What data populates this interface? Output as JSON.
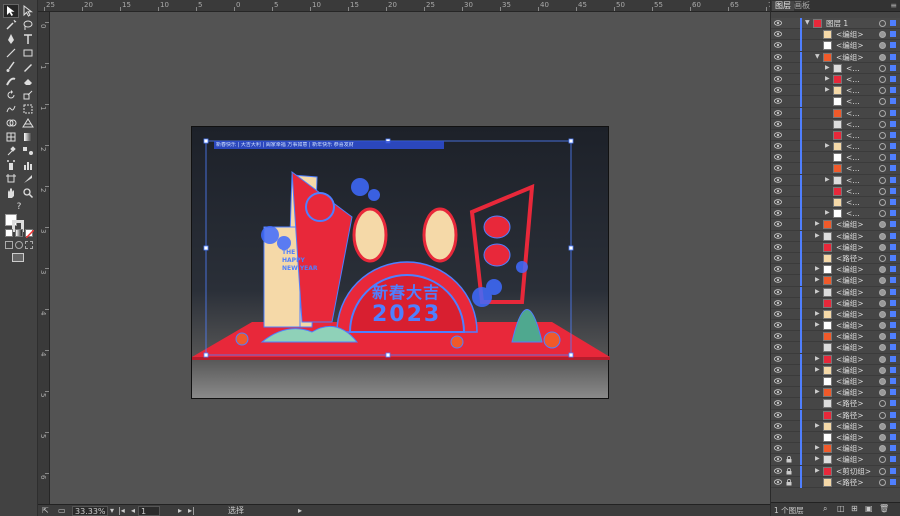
{
  "statusbar": {
    "zoom": "33.33%",
    "artboard_number": "1",
    "tool_status": "选择"
  },
  "ruler": {
    "top": [
      "25",
      "20",
      "15",
      "10",
      "5",
      "0",
      "5",
      "10",
      "15",
      "20",
      "25",
      "30",
      "35",
      "40",
      "45",
      "50",
      "55",
      "60",
      "65",
      "70"
    ],
    "left": [
      "0",
      "1",
      "1",
      "2",
      "2",
      "3",
      "3",
      "4",
      "4",
      "5",
      "5",
      "6"
    ]
  },
  "layers_panel": {
    "tabs": [
      "图层",
      "画板"
    ],
    "footer_text": "1 个图层",
    "rows": [
      {
        "name": "图层 1",
        "indent": 0,
        "arrow": "▼",
        "target": "empty",
        "highlight": true
      },
      {
        "name": "<编组>",
        "indent": 1,
        "arrow": "",
        "target": "filled"
      },
      {
        "name": "<编组>",
        "indent": 1,
        "arrow": "",
        "target": "filled"
      },
      {
        "name": "<编组>",
        "indent": 1,
        "arrow": "▼",
        "target": "filled"
      },
      {
        "name": "<…",
        "indent": 2,
        "arrow": "▶",
        "target": "empty"
      },
      {
        "name": "<…",
        "indent": 2,
        "arrow": "▶",
        "target": "empty"
      },
      {
        "name": "<…",
        "indent": 2,
        "arrow": "▶",
        "target": "empty"
      },
      {
        "name": "<…",
        "indent": 2,
        "arrow": "",
        "target": "empty"
      },
      {
        "name": "<…",
        "indent": 2,
        "arrow": "",
        "target": "empty"
      },
      {
        "name": "<…",
        "indent": 2,
        "arrow": "",
        "target": "empty"
      },
      {
        "name": "<…",
        "indent": 2,
        "arrow": "",
        "target": "empty"
      },
      {
        "name": "<…",
        "indent": 2,
        "arrow": "▶",
        "target": "empty"
      },
      {
        "name": "<…",
        "indent": 2,
        "arrow": "",
        "target": "empty"
      },
      {
        "name": "<…",
        "indent": 2,
        "arrow": "",
        "target": "empty"
      },
      {
        "name": "<…",
        "indent": 2,
        "arrow": "▶",
        "target": "empty"
      },
      {
        "name": "<…",
        "indent": 2,
        "arrow": "",
        "target": "empty"
      },
      {
        "name": "<…",
        "indent": 2,
        "arrow": "",
        "target": "empty"
      },
      {
        "name": "<…",
        "indent": 2,
        "arrow": "▶",
        "target": "empty"
      },
      {
        "name": "<编组>",
        "indent": 1,
        "arrow": "▶",
        "target": "filled"
      },
      {
        "name": "<编组>",
        "indent": 1,
        "arrow": "▶",
        "target": "filled"
      },
      {
        "name": "<编组>",
        "indent": 1,
        "arrow": "",
        "target": "filled"
      },
      {
        "name": "<路径>",
        "indent": 1,
        "arrow": "",
        "target": "empty"
      },
      {
        "name": "<编组>",
        "indent": 1,
        "arrow": "▶",
        "target": "filled"
      },
      {
        "name": "<编组>",
        "indent": 1,
        "arrow": "▶",
        "target": "filled"
      },
      {
        "name": "<编组>",
        "indent": 1,
        "arrow": "▶",
        "target": "filled"
      },
      {
        "name": "<编组>",
        "indent": 1,
        "arrow": "",
        "target": "filled"
      },
      {
        "name": "<编组>",
        "indent": 1,
        "arrow": "▶",
        "target": "filled"
      },
      {
        "name": "<编组>",
        "indent": 1,
        "arrow": "▶",
        "target": "filled"
      },
      {
        "name": "<编组>",
        "indent": 1,
        "arrow": "",
        "target": "filled"
      },
      {
        "name": "<编组>",
        "indent": 1,
        "arrow": "",
        "target": "filled"
      },
      {
        "name": "<编组>",
        "indent": 1,
        "arrow": "▶",
        "target": "filled"
      },
      {
        "name": "<编组>",
        "indent": 1,
        "arrow": "▶",
        "target": "filled"
      },
      {
        "name": "<编组>",
        "indent": 1,
        "arrow": "",
        "target": "filled"
      },
      {
        "name": "<编组>",
        "indent": 1,
        "arrow": "▶",
        "target": "filled"
      },
      {
        "name": "<路径>",
        "indent": 1,
        "arrow": "",
        "target": "empty"
      },
      {
        "name": "<路径>",
        "indent": 1,
        "arrow": "",
        "target": "empty"
      },
      {
        "name": "<编组>",
        "indent": 1,
        "arrow": "▶",
        "target": "filled"
      },
      {
        "name": "<编组>",
        "indent": 1,
        "arrow": "",
        "target": "filled"
      },
      {
        "name": "<编组>",
        "indent": 1,
        "arrow": "▶",
        "target": "filled"
      },
      {
        "name": "<编组>",
        "indent": 1,
        "arrow": "▶",
        "target": "empty"
      },
      {
        "name": "<剪切组>",
        "indent": 1,
        "arrow": "▶",
        "target": "empty"
      },
      {
        "name": "<路径>",
        "indent": 1,
        "arrow": "",
        "target": "empty"
      }
    ]
  },
  "artboard": {
    "headline": "2023",
    "center_title": "新春大吉",
    "side_text": [
      "THE",
      "HAPPY",
      "NEW YEAR"
    ],
    "top_caption": "新春快乐 | 大吉大利 | 阖家幸福 万事如意 | 新年快乐 恭喜发财"
  },
  "colors": {
    "selection": "#4f7fff",
    "red": "#e8283a",
    "cream": "#f5d9a8",
    "panel": "#464646"
  }
}
